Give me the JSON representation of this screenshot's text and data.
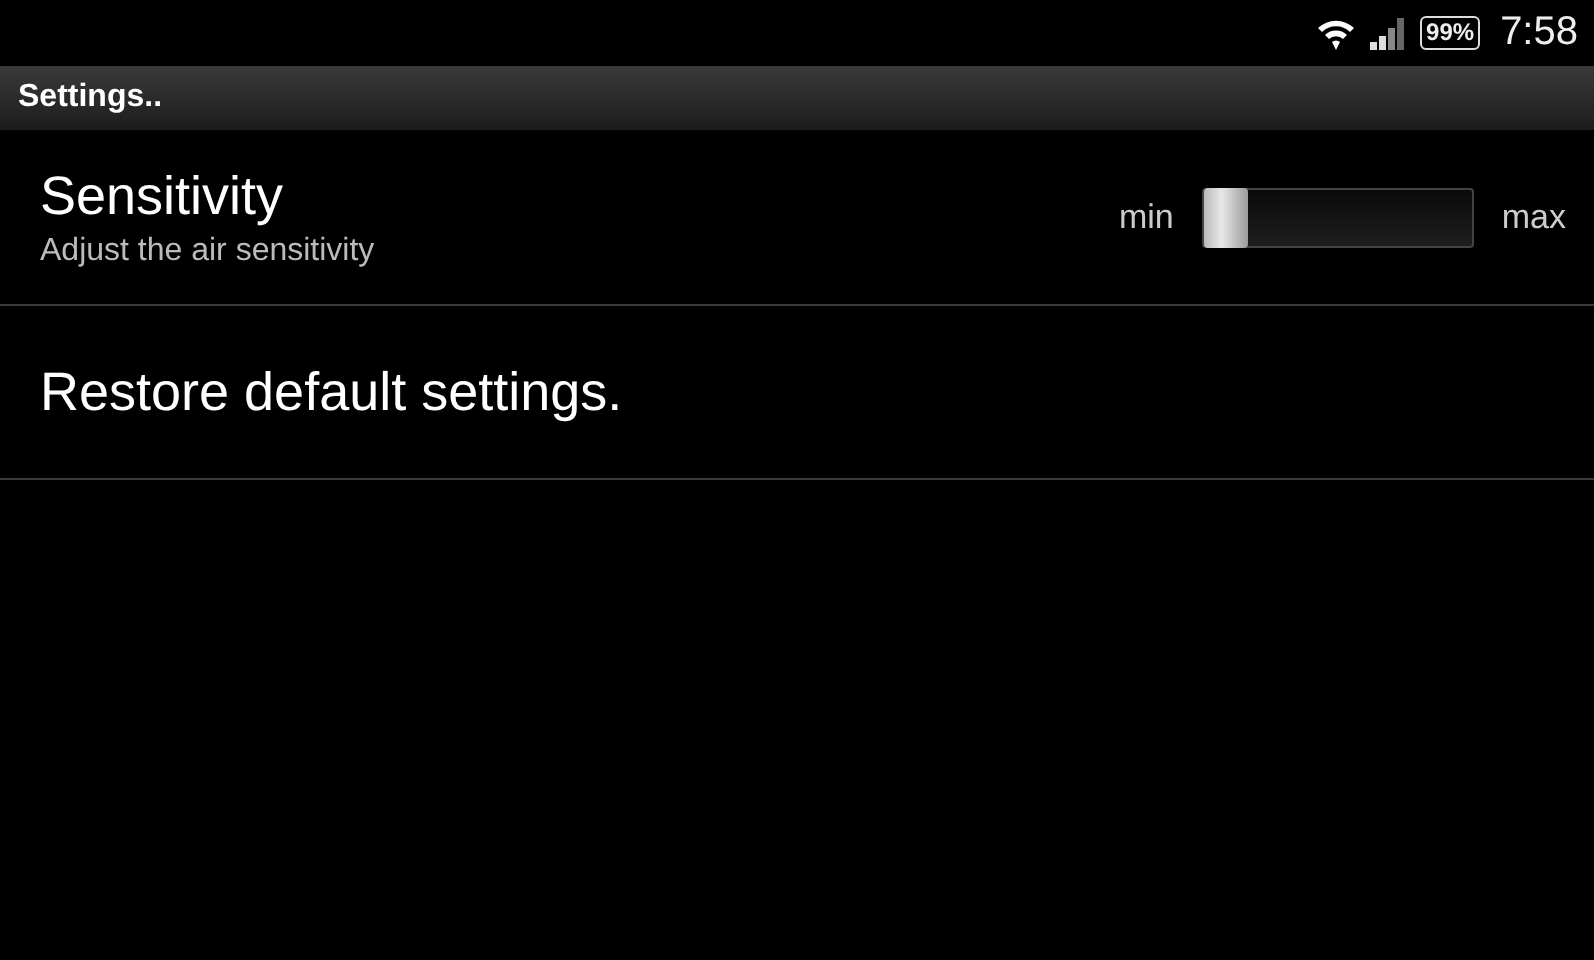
{
  "status_bar": {
    "battery": "99%",
    "time": "7:58"
  },
  "title_bar": {
    "title": "Settings.."
  },
  "settings": [
    {
      "kind": "slider",
      "title": "Sensitivity",
      "summary": "Adjust the air sensitivity",
      "min_label": "min",
      "max_label": "max",
      "level": 0
    },
    {
      "kind": "action",
      "title": "Restore default settings."
    }
  ]
}
